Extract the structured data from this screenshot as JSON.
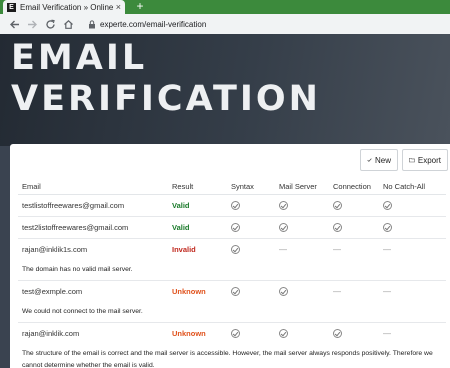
{
  "browser": {
    "tab_title": "Email Verification » Online Email",
    "tab_favicon": "E",
    "close_glyph": "×",
    "new_tab_glyph": "+",
    "url": "experte.com/email-verification",
    "icons": [
      "back-icon",
      "forward-icon",
      "reload-icon",
      "home-icon",
      "lock-icon"
    ]
  },
  "hero": {
    "line1": "EMAIL",
    "line2": "VERIFICATION"
  },
  "actions": {
    "new_label": "New",
    "export_label": "Export"
  },
  "table": {
    "headers": {
      "email": "Email",
      "result": "Result",
      "syntax": "Syntax",
      "mail_server": "Mail Server",
      "connection": "Connection",
      "no_catch_all": "No Catch-All"
    },
    "rows": [
      {
        "email": "testlistoffreewares@gmail.com",
        "result": "Valid"
      },
      {
        "email": "test2listoffreewares@gmail.com",
        "result": "Valid"
      },
      {
        "email": "rajan@inklik1s.com",
        "result": "Invalid",
        "message": "The domain has no valid mail server."
      },
      {
        "email": "test@exmple.com",
        "result": "Unknown",
        "message": "We could not connect to the mail server."
      },
      {
        "email": "rajan@inklik.com",
        "result": "Unknown",
        "message": "The structure of the email is correct and the mail server is accessible. However, the mail server always responds positively. Therefore we cannot determine whether the email is valid."
      }
    ],
    "dash": "—"
  },
  "colors": {
    "valid": "#1a7a2a",
    "invalid": "#c0281e",
    "unknown": "#e0521c",
    "tabstrip": "#3c8a3c"
  }
}
